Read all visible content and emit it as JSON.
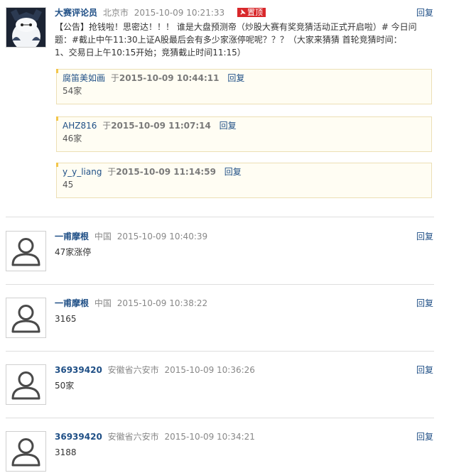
{
  "posts": [
    {
      "author": "大赛评论员",
      "location": "北京市",
      "time": "2015-10-09 10:21:33",
      "pin_label": "置顶",
      "reply_label": "回复",
      "content_lines": [
        "【公告】抢钱啦！思密达！！！ 谁是大盘预测帝（炒股大赛有奖竞猜活动正式开启啦）# 今日问",
        "题：#截止中午11:30上证A股最后会有多少家涨停呢呢？？？（大家来猜猜 首轮竞猜时间：",
        "1、交易日上午10:15开始；竞猜截止时间11:15）"
      ],
      "replies": [
        {
          "user": "腐笛美如画",
          "yu": "于",
          "time": "2015-10-09 10:44:11",
          "reply_label": "回复",
          "text": "54家"
        },
        {
          "user": "AHZ816",
          "yu": "于",
          "time": "2015-10-09 11:07:14",
          "reply_label": "回复",
          "text": "46家"
        },
        {
          "user": "y_y_liang",
          "yu": "于",
          "time": "2015-10-09 11:14:59",
          "reply_label": "回复",
          "text": "45"
        }
      ]
    },
    {
      "author": "一甫摩根",
      "location": "中国",
      "time": "2015-10-09 10:40:39",
      "reply_label": "回复",
      "text": "47家涨停"
    },
    {
      "author": "一甫摩根",
      "location": "中国",
      "time": "2015-10-09 10:38:22",
      "reply_label": "回复",
      "text": "3165"
    },
    {
      "author": "36939420",
      "location": "安徽省六安市",
      "time": "2015-10-09 10:36:26",
      "reply_label": "回复",
      "text": "50家"
    },
    {
      "author": "36939420",
      "location": "安徽省六安市",
      "time": "2015-10-09 10:34:21",
      "reply_label": "回复",
      "text": "3188"
    }
  ],
  "colors": {
    "name": "#1f4f86",
    "pin_bg": "#d8282b",
    "reply_box_bg": "#fffdf3",
    "reply_box_border": "#ecdfb5"
  },
  "icons": {
    "announcer_avatar": "robot-hero-avatar",
    "default_avatar": "user-silhouette-icon",
    "pin": "pushpin-icon"
  }
}
